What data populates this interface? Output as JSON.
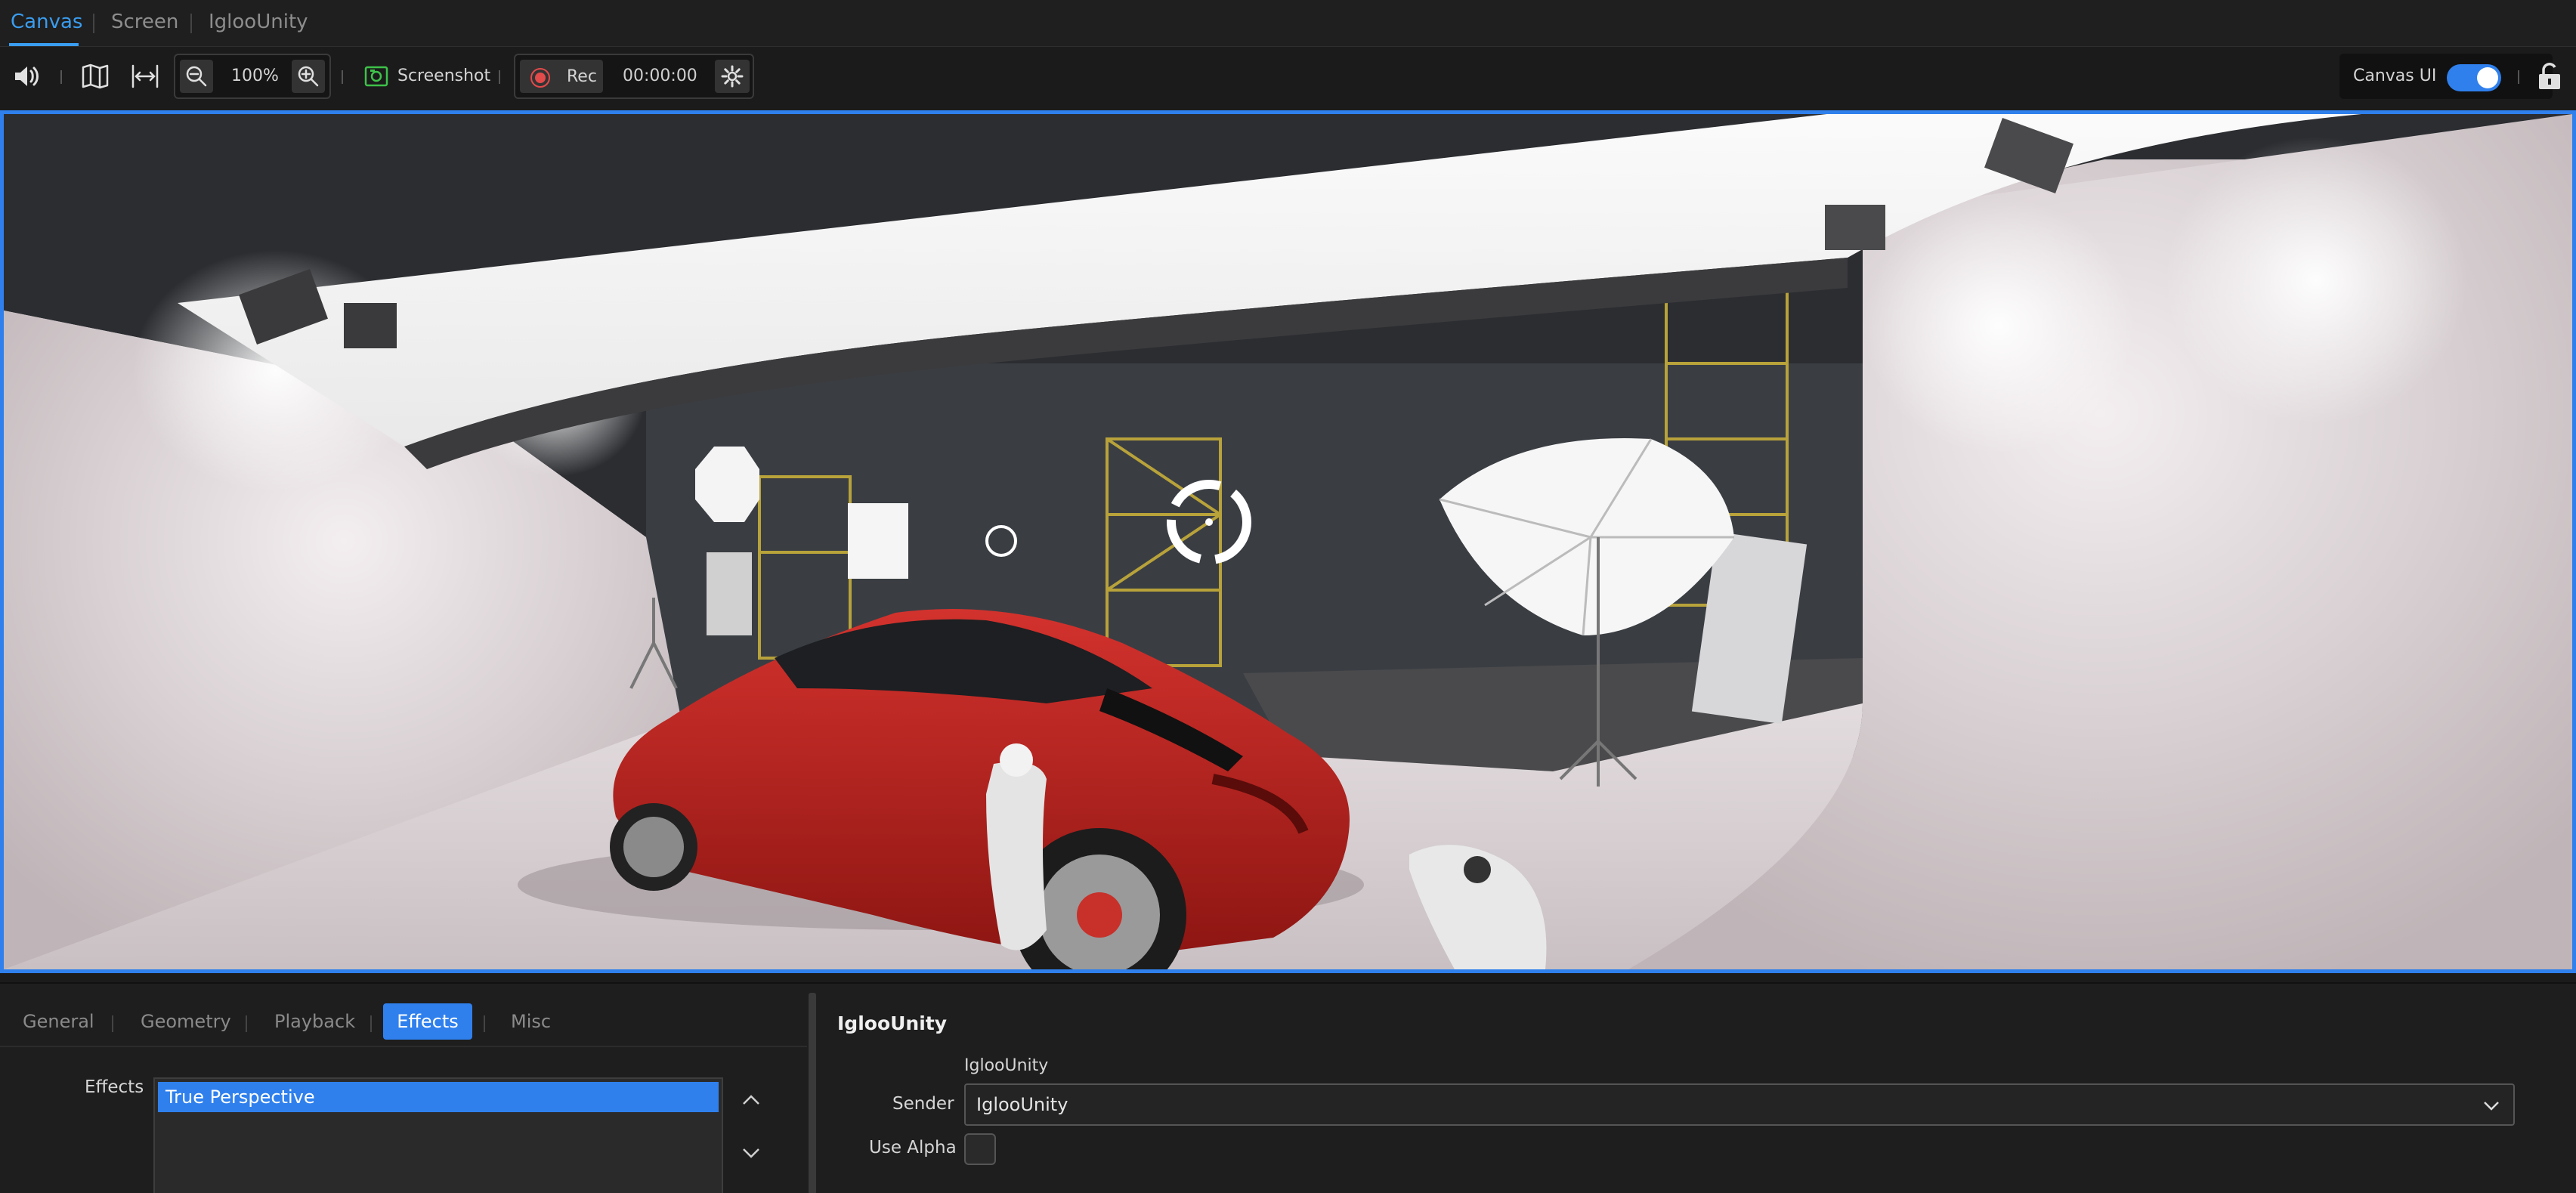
{
  "tabs": [
    {
      "label": "Canvas",
      "active": true
    },
    {
      "label": "Screen",
      "active": false
    },
    {
      "label": "IglooUnity",
      "active": false
    }
  ],
  "toolbar": {
    "zoom_value": "100%",
    "screenshot_label": "Screenshot",
    "rec_label": "Rec",
    "timer": "00:00:00",
    "canvas_ui_label": "Canvas UI",
    "canvas_ui_enabled": true,
    "icons": [
      "speaker-icon",
      "map-icon",
      "fit-width-icon",
      "zoom-out-icon",
      "zoom-in-icon",
      "camera-icon",
      "record-icon",
      "gear-icon",
      "lock-icon"
    ]
  },
  "bottom": {
    "subtabs": [
      {
        "label": "General",
        "active": false
      },
      {
        "label": "Geometry",
        "active": false
      },
      {
        "label": "Playback",
        "active": false
      },
      {
        "label": "Effects",
        "active": true
      },
      {
        "label": "Misc",
        "active": false
      }
    ],
    "effects_label": "Effects",
    "effects_items": [
      "True Perspective"
    ],
    "panel_title": "IglooUnity",
    "sender_caption": "IglooUnity",
    "sender_label": "Sender",
    "sender_value": "IglooUnity",
    "use_alpha_label": "Use Alpha",
    "use_alpha_checked": false
  },
  "colors": {
    "accent": "#2f80ed",
    "active_tab": "#3a9df0",
    "record": "#e34a4a",
    "screenshot_icon": "#3ec24a"
  }
}
